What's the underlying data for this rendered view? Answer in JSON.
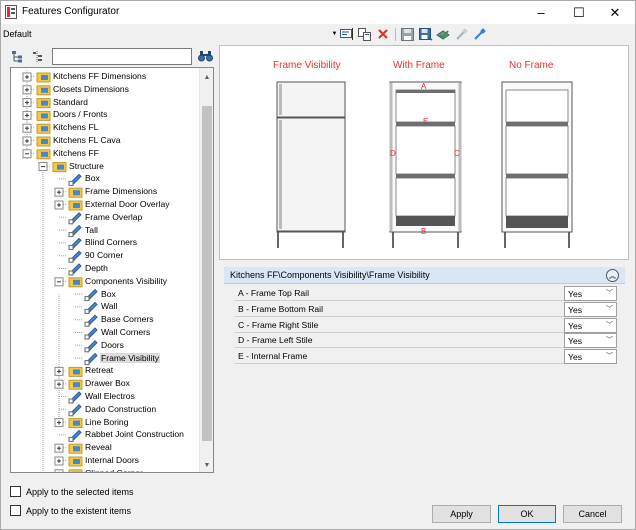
{
  "window": {
    "title": "Features Configurator",
    "controls": {
      "minimize": "–",
      "maximize": "☐",
      "close": "✕"
    }
  },
  "preset": "Default",
  "toolbar": {
    "icons": [
      "properties-icon",
      "copy-icon",
      "delete-icon",
      "save-icon",
      "save-as-icon",
      "validate-icon",
      "pick-icon",
      "link-icon"
    ]
  },
  "search": {
    "value": "",
    "placeholder": ""
  },
  "tree": {
    "items": [
      {
        "label": "Kitchens FF Dimensions",
        "level": 0,
        "expander": "plus",
        "icon": "folder"
      },
      {
        "label": "Closets Dimensions",
        "level": 0,
        "expander": "plus",
        "icon": "folder"
      },
      {
        "label": "Standard",
        "level": 0,
        "expander": "plus",
        "icon": "folder"
      },
      {
        "label": "Doors / Fronts",
        "level": 0,
        "expander": "plus",
        "icon": "folder"
      },
      {
        "label": "Kitchens FL",
        "level": 0,
        "expander": "plus",
        "icon": "folder"
      },
      {
        "label": "Kitchens FL Cava",
        "level": 0,
        "expander": "plus",
        "icon": "folder"
      },
      {
        "label": "Kitchens FF",
        "level": 0,
        "expander": "minus",
        "icon": "folder"
      },
      {
        "label": "Structure",
        "level": 1,
        "expander": "minus",
        "icon": "folder"
      },
      {
        "label": "Box",
        "level": 2,
        "expander": "none",
        "icon": "item"
      },
      {
        "label": "Frame Dimensions",
        "level": 2,
        "expander": "plus",
        "icon": "folder"
      },
      {
        "label": "External Door Overlay",
        "level": 2,
        "expander": "plus",
        "icon": "folder"
      },
      {
        "label": "Frame Overlap",
        "level": 2,
        "expander": "none",
        "icon": "item"
      },
      {
        "label": "Tall",
        "level": 2,
        "expander": "none",
        "icon": "item"
      },
      {
        "label": "Blind Corners",
        "level": 2,
        "expander": "none",
        "icon": "item"
      },
      {
        "label": "90 Corner",
        "level": 2,
        "expander": "none",
        "icon": "item"
      },
      {
        "label": "Depth",
        "level": 2,
        "expander": "none",
        "icon": "item"
      },
      {
        "label": "Components Visibility",
        "level": 2,
        "expander": "minus",
        "icon": "folder"
      },
      {
        "label": "Box",
        "level": 3,
        "expander": "none",
        "icon": "item"
      },
      {
        "label": "Wall",
        "level": 3,
        "expander": "none",
        "icon": "item"
      },
      {
        "label": "Base Corners",
        "level": 3,
        "expander": "none",
        "icon": "item"
      },
      {
        "label": "Wall Corners",
        "level": 3,
        "expander": "none",
        "icon": "item"
      },
      {
        "label": "Doors",
        "level": 3,
        "expander": "none",
        "icon": "item"
      },
      {
        "label": "Frame Visibility",
        "level": 3,
        "expander": "none",
        "icon": "item",
        "selected": true
      },
      {
        "label": "Retreat",
        "level": 2,
        "expander": "plus",
        "icon": "folder"
      },
      {
        "label": "Drawer Box",
        "level": 2,
        "expander": "plus",
        "icon": "folder"
      },
      {
        "label": "Wall Electros",
        "level": 2,
        "expander": "none",
        "icon": "item"
      },
      {
        "label": "Dado Construction",
        "level": 2,
        "expander": "none",
        "icon": "item"
      },
      {
        "label": "Line Boring",
        "level": 2,
        "expander": "plus",
        "icon": "folder"
      },
      {
        "label": "Rabbet Joint Construction",
        "level": 2,
        "expander": "none",
        "icon": "item"
      },
      {
        "label": "Reveal",
        "level": 2,
        "expander": "plus",
        "icon": "folder"
      },
      {
        "label": "Internal Doors",
        "level": 2,
        "expander": "plus",
        "icon": "folder"
      },
      {
        "label": "Clipped Corner",
        "level": 2,
        "expander": "plus",
        "icon": "folder"
      }
    ]
  },
  "options": {
    "apply_selected": "Apply to the selected items",
    "apply_existent": "Apply to the existent items"
  },
  "preview": {
    "labels": [
      "Frame Visibility",
      "With Frame",
      "No Frame"
    ],
    "markers": {
      "a": "A",
      "b": "B",
      "c": "C",
      "d": "D",
      "e": "E"
    },
    "marker_color": "#e0342f"
  },
  "properties": {
    "path": "Kitchens FF\\Components Visibility\\Frame Visibility",
    "rows": [
      {
        "name": "A - Frame Top Rail",
        "value": "Yes"
      },
      {
        "name": "B - Frame Bottom Rail",
        "value": "Yes"
      },
      {
        "name": "C - Frame Right Stile",
        "value": "Yes"
      },
      {
        "name": "D - Frame Left Stile",
        "value": "Yes"
      },
      {
        "name": "E - Internal Frame",
        "value": "Yes"
      }
    ]
  },
  "buttons": {
    "apply": "Apply",
    "ok": "OK",
    "cancel": "Cancel"
  }
}
